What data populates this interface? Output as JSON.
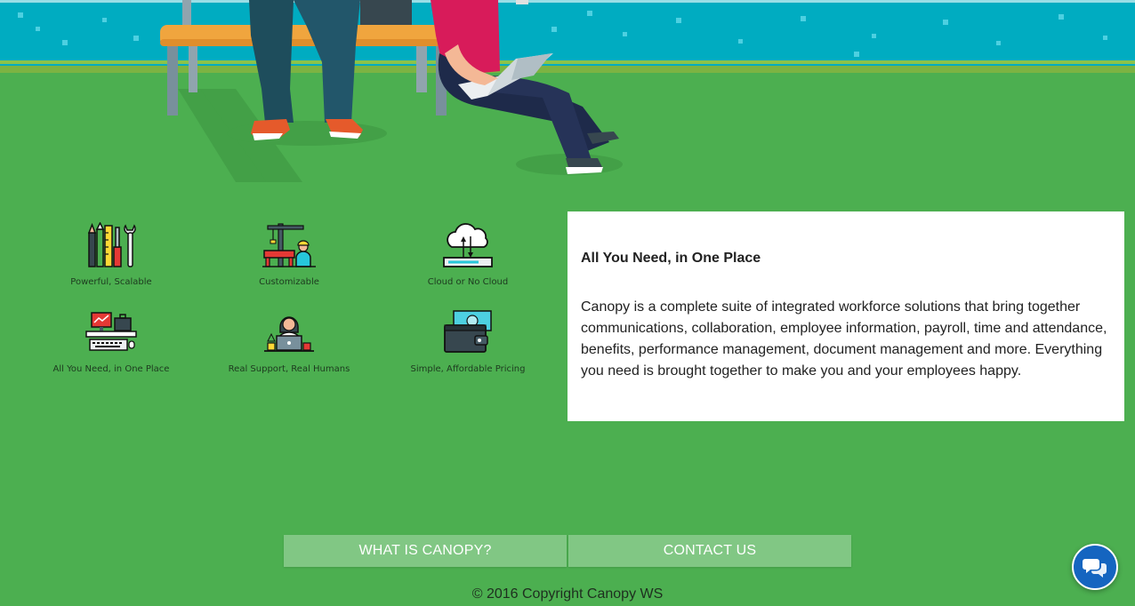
{
  "features": [
    {
      "label": "Powerful, Scalable",
      "icon": "tools-icon"
    },
    {
      "label": "Customizable",
      "icon": "construction-crane-icon"
    },
    {
      "label": "Cloud or No Cloud",
      "icon": "cloud-sync-icon"
    },
    {
      "label": "All You Need, in One Place",
      "icon": "workstation-icon"
    },
    {
      "label": "Real Support, Real Humans",
      "icon": "support-agent-icon"
    },
    {
      "label": "Simple, Affordable Pricing",
      "icon": "wallet-icon"
    }
  ],
  "info_card": {
    "title": "All You Need, in One Place",
    "body": "Canopy is a complete suite of integrated workforce solutions that bring together communications, collaboration, employee information, payroll, time and attendance, benefits, performance management, document management and more. Everything you need is brought together to make you and your employees happy."
  },
  "nav": {
    "what_is_label": "WHAT IS CANOPY?",
    "contact_label": "CONTACT US"
  },
  "footer": {
    "copyright": "© 2016 Copyright Canopy WS"
  },
  "chat": {
    "icon": "chat-bubbles-icon"
  },
  "colors": {
    "background_green": "#4caf50",
    "button_green": "#81c784",
    "sky_blue": "#00acc1",
    "chat_blue": "#1565c0"
  }
}
